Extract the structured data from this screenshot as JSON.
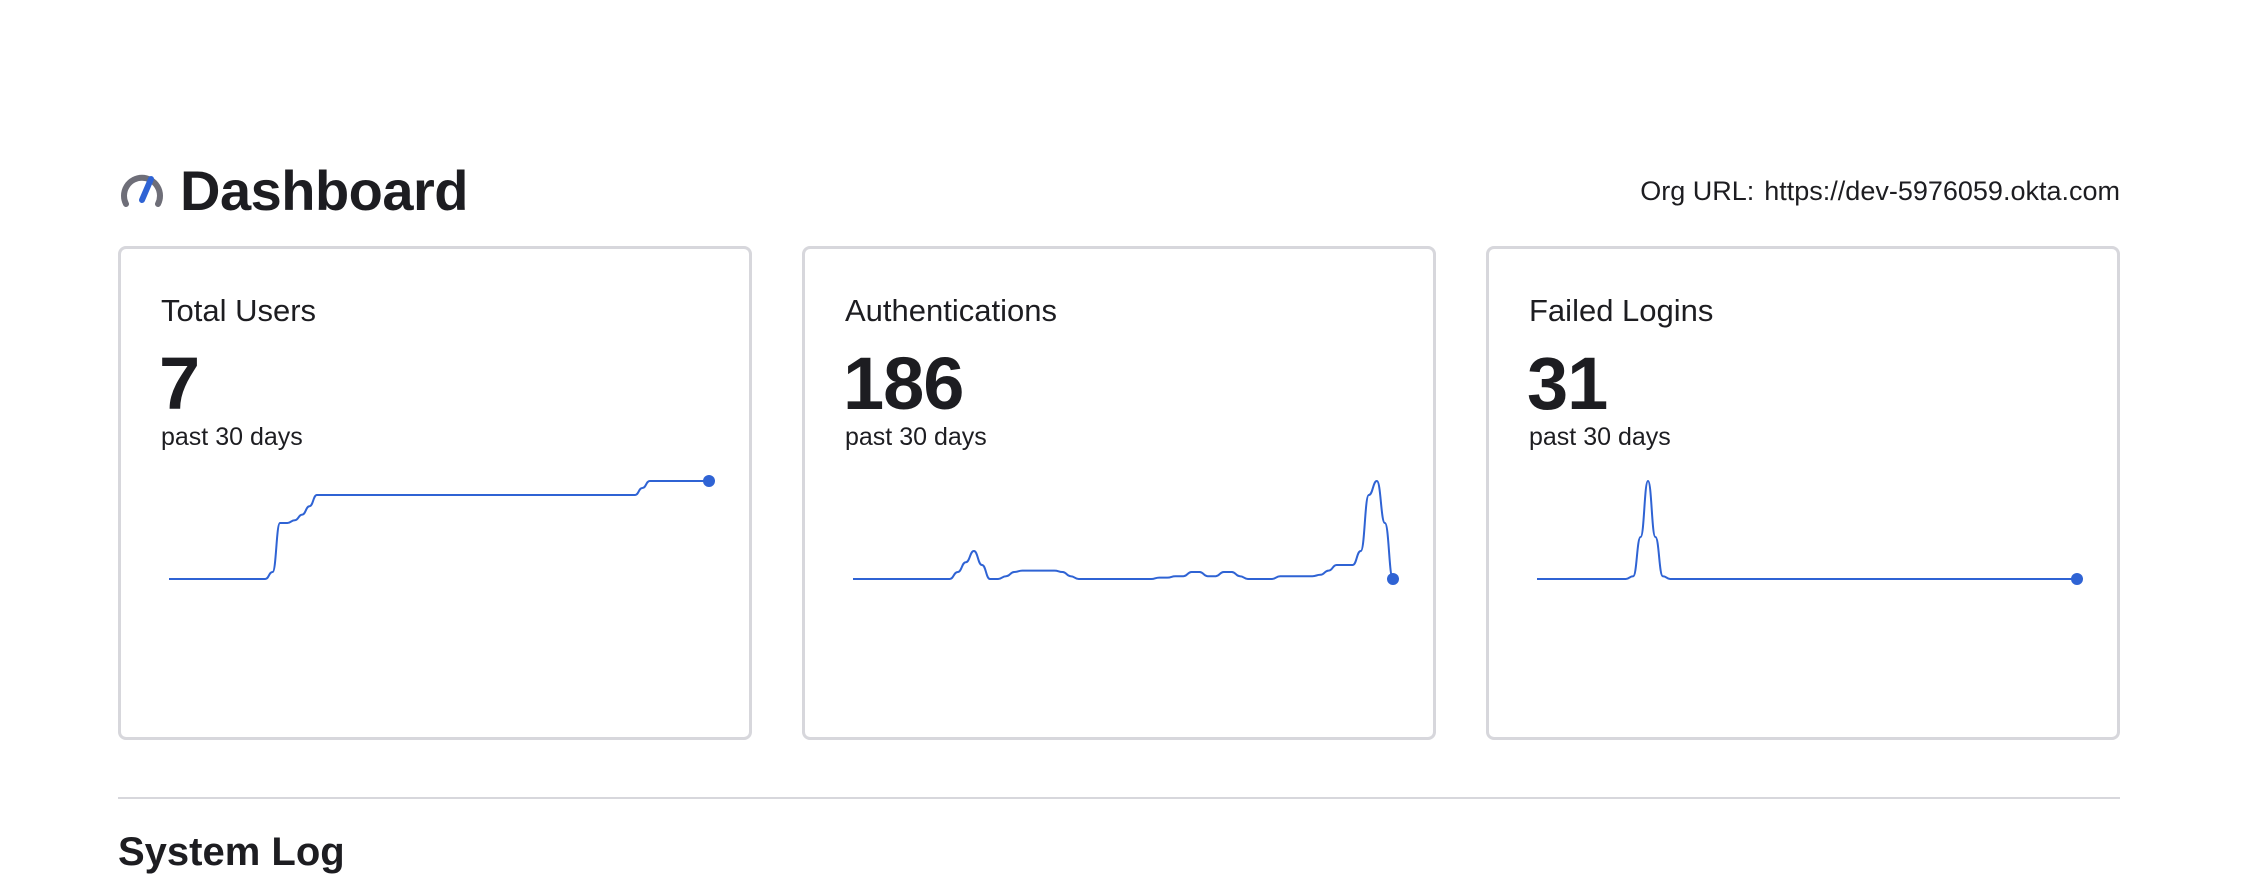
{
  "header": {
    "title": "Dashboard",
    "icon": "speedometer-icon",
    "org_url_label": "Org URL:",
    "org_url_value": "https://dev-5976059.okta.com"
  },
  "cards": [
    {
      "title": "Total Users",
      "value": "7",
      "subtitle": "past 30 days",
      "series": [
        0,
        0,
        0,
        0,
        0,
        0,
        0,
        0,
        0,
        0,
        0,
        0,
        0,
        0,
        0.5,
        4,
        4,
        4.2,
        4.6,
        5.2,
        6,
        6,
        6,
        6,
        6,
        6,
        6,
        6,
        6,
        6,
        6,
        6,
        6,
        6,
        6,
        6,
        6,
        6,
        6,
        6,
        6,
        6,
        6,
        6,
        6,
        6,
        6,
        6,
        6,
        6,
        6,
        6,
        6,
        6,
        6,
        6,
        6,
        6,
        6,
        6,
        6,
        6,
        6,
        6,
        6.5,
        7,
        7,
        7,
        7,
        7,
        7,
        7,
        7,
        7
      ]
    },
    {
      "title": "Authentications",
      "value": "186",
      "subtitle": "past 30 days",
      "series": [
        0,
        0,
        0,
        0,
        0,
        0,
        0,
        0,
        0,
        0,
        0,
        0,
        0,
        0.5,
        1.2,
        2,
        1,
        0,
        0,
        0.2,
        0.5,
        0.6,
        0.6,
        0.6,
        0.6,
        0.6,
        0.5,
        0.2,
        0,
        0,
        0,
        0,
        0,
        0,
        0,
        0,
        0,
        0,
        0.1,
        0.1,
        0.2,
        0.2,
        0.5,
        0.5,
        0.2,
        0.2,
        0.5,
        0.5,
        0.2,
        0,
        0,
        0,
        0,
        0.2,
        0.2,
        0.2,
        0.2,
        0.2,
        0.3,
        0.6,
        1,
        1,
        1,
        2,
        6,
        7,
        4,
        0
      ]
    },
    {
      "title": "Failed Logins",
      "value": "31",
      "subtitle": "past 30 days",
      "series": [
        0,
        0,
        0,
        0,
        0,
        0,
        0,
        0,
        0,
        0,
        0,
        0,
        0,
        0.2,
        3,
        7,
        3,
        0.2,
        0,
        0,
        0,
        0,
        0,
        0,
        0,
        0,
        0,
        0,
        0,
        0,
        0,
        0,
        0,
        0,
        0,
        0,
        0,
        0,
        0,
        0,
        0,
        0,
        0,
        0,
        0,
        0,
        0,
        0,
        0,
        0,
        0,
        0,
        0,
        0,
        0,
        0,
        0,
        0,
        0,
        0,
        0,
        0,
        0,
        0,
        0,
        0,
        0,
        0,
        0,
        0,
        0,
        0,
        0,
        0
      ]
    }
  ],
  "colors": {
    "line": "#2f63d4",
    "border": "#d7d7dc",
    "text": "#1d1d21",
    "icon_gray": "#6e6e78",
    "icon_blue": "#2f63d4"
  },
  "section": {
    "title": "System Log"
  }
}
